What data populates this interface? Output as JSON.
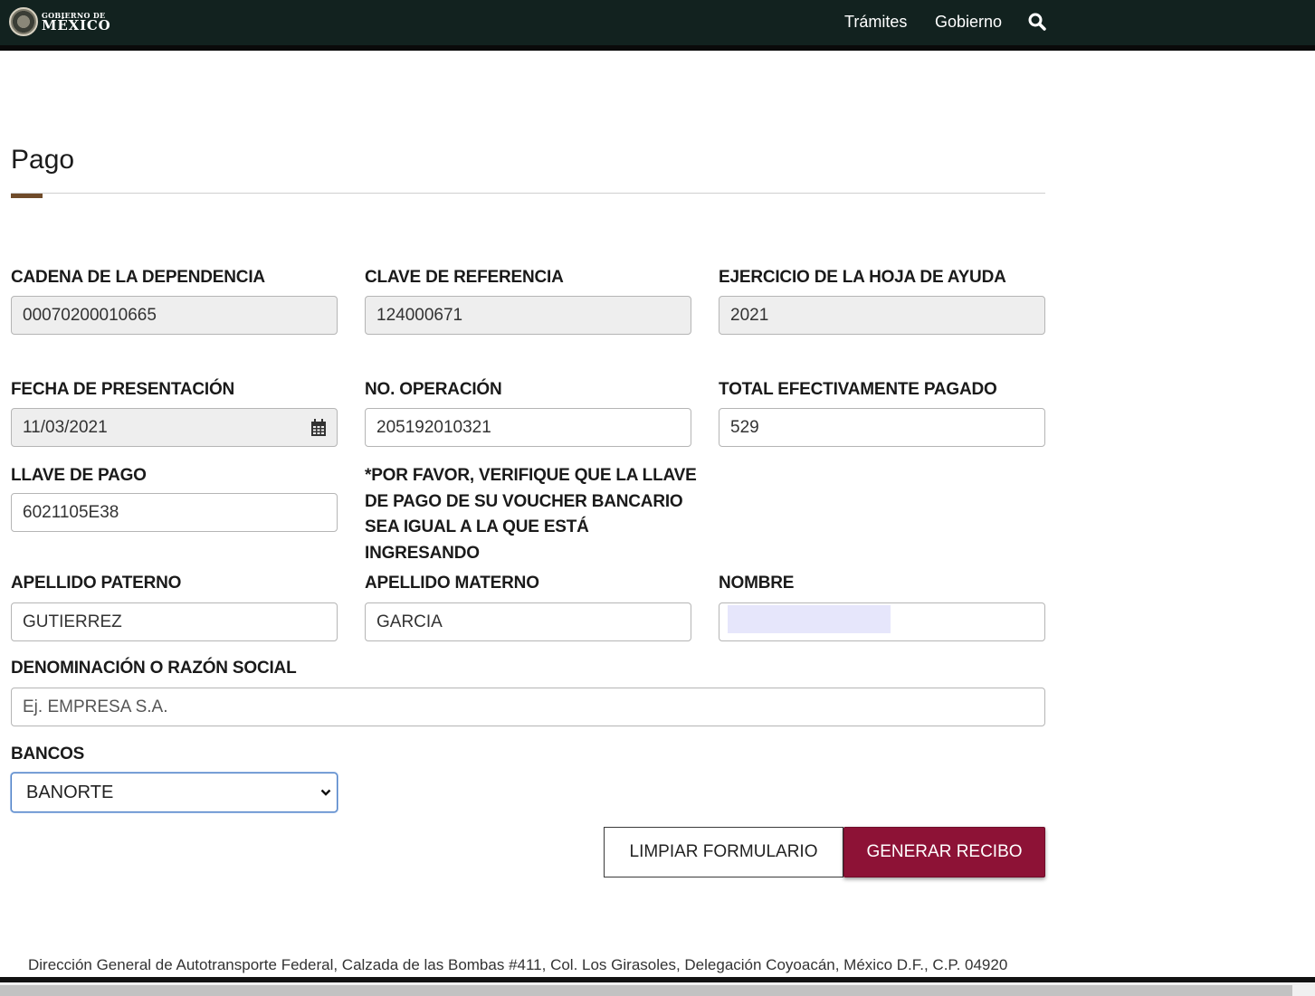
{
  "nav": {
    "logo_small": "GOBIERNO DE",
    "logo_big": "MÉXICO",
    "links": [
      "Trámites",
      "Gobierno"
    ]
  },
  "page": {
    "title": "Pago"
  },
  "form": {
    "cadena": {
      "label": "CADENA DE LA DEPENDENCIA",
      "value": "00070200010665"
    },
    "clave": {
      "label": "CLAVE DE REFERENCIA",
      "value": "124000671"
    },
    "ejercicio": {
      "label": "EJERCICIO DE LA HOJA DE AYUDA",
      "value": "2021"
    },
    "fecha": {
      "label": "FECHA DE PRESENTACIÓN",
      "value": "11/03/2021"
    },
    "operacion": {
      "label": "NO. OPERACIÓN",
      "value": "205192010321"
    },
    "total": {
      "label": "TOTAL EFECTIVAMENTE PAGADO",
      "value": "529"
    },
    "llave": {
      "label": "LLAVE DE PAGO",
      "value": "6021105E38"
    },
    "note": "*POR FAVOR, VERIFIQUE QUE LA LLAVE DE PAGO DE SU VOUCHER BANCARIO SEA IGUAL A LA QUE ESTÁ INGRESANDO",
    "paterno": {
      "label": "APELLIDO PATERNO",
      "value": "GUTIERREZ"
    },
    "materno": {
      "label": "APELLIDO MATERNO",
      "value": "GARCIA"
    },
    "nombre": {
      "label": "NOMBRE",
      "value": ""
    },
    "razon": {
      "label": "DENOMINACIÓN O RAZÓN SOCIAL",
      "placeholder": "Ej. EMPRESA S.A.",
      "value": ""
    },
    "bancos": {
      "label": "BANCOS",
      "selected": "BANORTE"
    }
  },
  "buttons": {
    "clear": "LIMPIAR FORMULARIO",
    "generate": "GENERAR RECIBO"
  },
  "footer": {
    "address": "Dirección General de Autotransporte Federal, Calzada de las Bombas #411, Col. Los Girasoles, Delegación Coyoacán, México D.F., C.P. 04920"
  },
  "colors": {
    "header_bg": "#12221f",
    "accent": "#8d1236",
    "title_accent": "#6f4b2a"
  }
}
